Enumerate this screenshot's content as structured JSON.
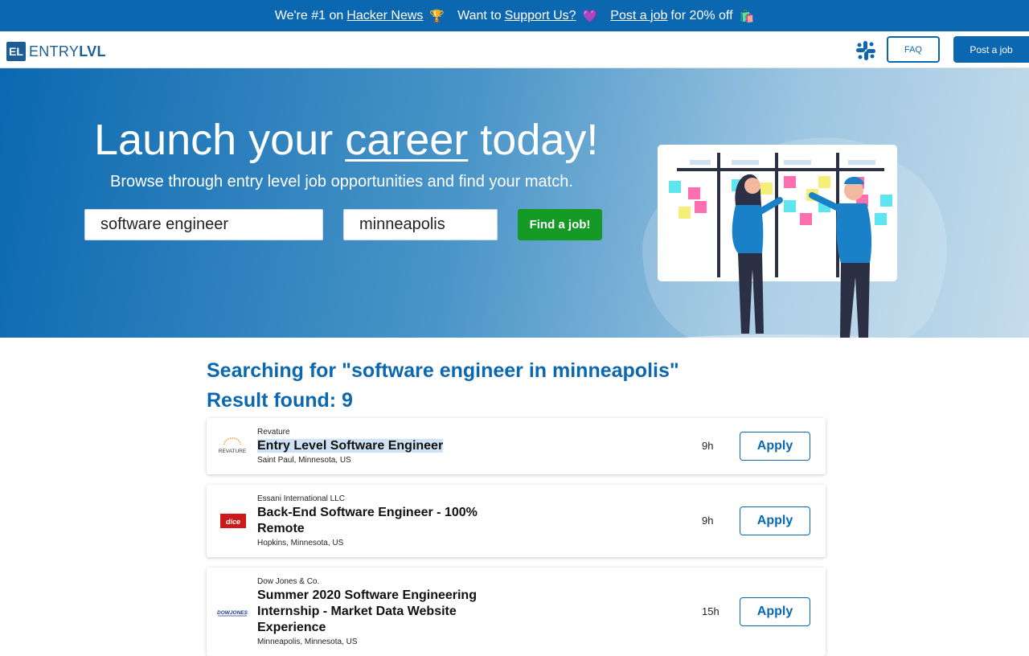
{
  "banner": {
    "part1_prefix": "We're #1 on",
    "part1_link": "Hacker News",
    "part1_emoji": "🏆",
    "part2_prefix": "Want to",
    "part2_link": "Support Us?",
    "part2_emoji": "💜",
    "part3_link": "Post a job",
    "part3_suffix": "for 20% off",
    "part3_emoji": "🛍️"
  },
  "header": {
    "logo_mark": "EL",
    "logo_text_light": "ENTRY",
    "logo_text_bold": "LVL",
    "slack_icon": "slack-icon",
    "faq_label": "FAQ",
    "post_job_label": "Post a job"
  },
  "hero": {
    "title_before": "Launch your ",
    "title_underlined": "career",
    "title_after": " today!",
    "subtitle": "Browse through entry level job opportunities and find your match.",
    "search_what": "software engineer",
    "search_where": "minneapolis",
    "find_label": "Find a job!"
  },
  "results": {
    "searching_text": "Searching for \"software engineer in minneapolis\"",
    "count_text": "Result found: 9",
    "jobs": [
      {
        "company": "Revature",
        "title": "Entry Level Software Engineer",
        "location": "Saint Paul, Minnesota, US",
        "age": "9h",
        "apply": "Apply",
        "logo_text": "REVATURE"
      },
      {
        "company": "Essani International LLC",
        "title": "Back-End Software Engineer - 100% Remote",
        "location": "Hopkins, Minnesota, US",
        "age": "9h",
        "apply": "Apply",
        "logo_text": "dice"
      },
      {
        "company": "Dow Jones & Co.",
        "title": "Summer 2020 Software Engineering Internship - Market Data Website Experience",
        "location": "Minneapolis, Minnesota, US",
        "age": "15h",
        "apply": "Apply",
        "logo_text": "DOWJONES"
      }
    ]
  },
  "colors": {
    "brand_blue": "#0b68b0",
    "find_green": "#159b25"
  }
}
